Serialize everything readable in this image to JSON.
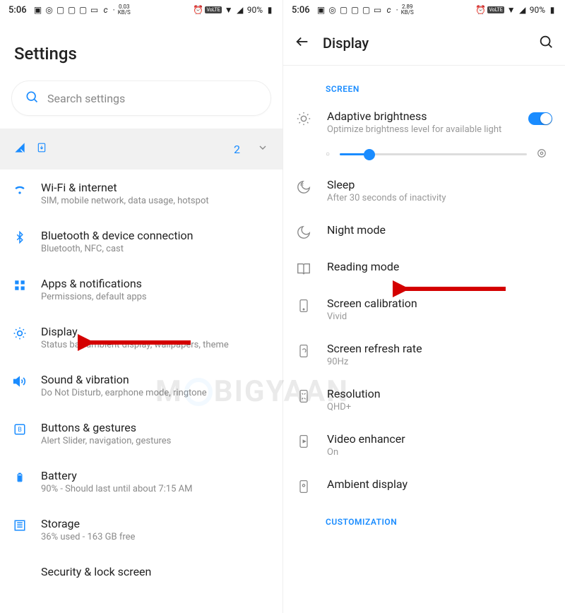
{
  "status": {
    "time": "5:06",
    "kbs_left": "0.03",
    "kbs_right": "2.89",
    "kbs_unit": "KB/S",
    "volte": "VoLTE",
    "battery": "90%"
  },
  "left": {
    "title": "Settings",
    "search_placeholder": "Search settings",
    "sim_count": "2",
    "items": [
      {
        "title": "Wi-Fi & internet",
        "sub": "SIM, mobile network, data usage, hotspot"
      },
      {
        "title": "Bluetooth & device connection",
        "sub": "Bluetooth, NFC, cast"
      },
      {
        "title": "Apps & notifications",
        "sub": "Permissions, default apps"
      },
      {
        "title": "Display",
        "sub": "Status bar, ambient display, wallpapers, theme"
      },
      {
        "title": "Sound & vibration",
        "sub": "Do Not Disturb, earphone mode, ringtone"
      },
      {
        "title": "Buttons & gestures",
        "sub": "Alert Slider, navigation, gestures"
      },
      {
        "title": "Battery",
        "sub": "90% - Should last until about 7:15 AM"
      },
      {
        "title": "Storage",
        "sub": "36% used - 163 GB free"
      },
      {
        "title": "Security & lock screen",
        "sub": ""
      }
    ]
  },
  "right": {
    "title": "Display",
    "section1": "SCREEN",
    "section2": "CUSTOMIZATION",
    "items": [
      {
        "title": "Adaptive brightness",
        "sub": "Optimize brightness level for available light"
      },
      {
        "title": "Sleep",
        "sub": "After 30 seconds of inactivity"
      },
      {
        "title": "Night mode",
        "sub": ""
      },
      {
        "title": "Reading mode",
        "sub": ""
      },
      {
        "title": "Screen calibration",
        "sub": "Vivid"
      },
      {
        "title": "Screen refresh rate",
        "sub": "90Hz"
      },
      {
        "title": "Resolution",
        "sub": "QHD+"
      },
      {
        "title": "Video enhancer",
        "sub": "On"
      },
      {
        "title": "Ambient display",
        "sub": ""
      }
    ]
  },
  "watermark": {
    "pre": "M",
    "post": "BIGYAAN"
  }
}
